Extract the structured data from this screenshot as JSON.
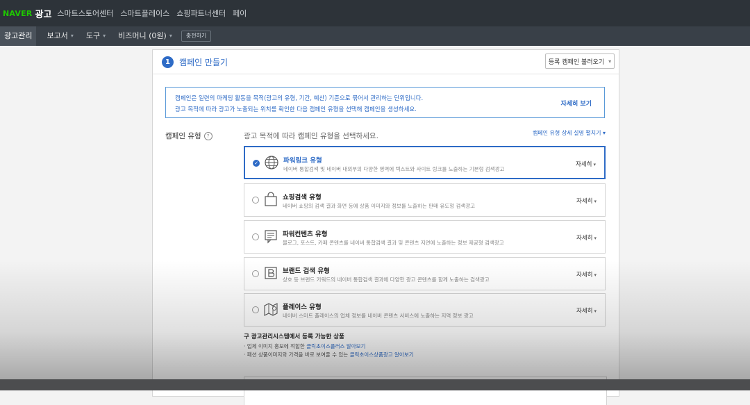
{
  "header": {
    "brand_naver": "NAVER",
    "brand_ad": "광고",
    "nav": [
      "스마트스토어센터",
      "스마트플레이스",
      "쇼핑파트너센터",
      "페이"
    ]
  },
  "subnav": {
    "items": [
      {
        "label": "광고관리",
        "active": true
      },
      {
        "label": "보고서"
      },
      {
        "label": "도구"
      },
      {
        "label": "비즈머니 (0원)"
      }
    ],
    "charge_label": "충전하기"
  },
  "card": {
    "step": "1",
    "title": "캠페인 만들기",
    "load_button": "등록 캠페인 불러오기",
    "info": {
      "line1": "캠페인은 일련의 마케팅 활동을 목적(광고의 유형, 기간, 예산) 기준으로 묶어서 관리하는 단위입니다.",
      "line2": "광고 목적에 따라 광고가 노출되는 위치를 확인한 다음 캠페인 유형을 선택해 캠페인을 생성하세요.",
      "more": "자세히 보기"
    },
    "type_label": "캠페인 유형",
    "help": "?",
    "prompt": "광고 목적에 따라 캠페인 유형을 선택하세요.",
    "expand_link": "캠페인 유형 상세 설명 펼치기 ▾"
  },
  "options": [
    {
      "title": "파워링크 유형",
      "desc": "네이버 통합검색 및 네이버 내외부의 다양한 영역에 텍스트와 사이트 링크를 노출하는 기본형 검색광고",
      "more": "자세히",
      "selected": true,
      "icon": "globe-icon"
    },
    {
      "title": "쇼핑검색 유형",
      "desc": "네이버 쇼핑의 검색 결과 화면 등에 상품 이미지와 정보를 노출하는 판매 유도형 검색광고",
      "more": "자세히",
      "selected": false,
      "icon": "shopping-bag-icon"
    },
    {
      "title": "파워컨텐츠 유형",
      "desc": "블로그, 포스트, 카페 콘텐츠를 네이버 통합검색 결과 및 콘텐츠 지면에 노출하는 정보 제공형 검색광고",
      "more": "자세히",
      "selected": false,
      "icon": "content-icon"
    },
    {
      "title": "브랜드 검색 유형",
      "desc": "상호 등 브랜드 키워드의 네이버 통합검색 결과에 다양한 광고 콘텐츠를 함께 노출하는 검색광고",
      "more": "자세히",
      "selected": false,
      "icon": "brand-b-icon"
    },
    {
      "title": "플레이스 유형",
      "desc": "네이버 스마트 플레이스의 업체 정보를 네이버 콘텐츠 서비스에 노출하는 지역 정보 광고",
      "more": "자세히",
      "selected": false,
      "icon": "place-map-icon"
    }
  ],
  "legacy": {
    "title": "구 광고관리시스템에서 등록 가능한 상품",
    "items": [
      {
        "prefix": "· 업체 이미지 홍보에 적합한 ",
        "link": "클릭초이스플러스 알아보기"
      },
      {
        "prefix": "· 패션 상품이미지와 가격을 바로 보여줄 수 있는 ",
        "link": "클릭초이스상품광고 알아보기"
      }
    ]
  },
  "colors": {
    "accent": "#2e6bc6",
    "header_bg": "#2d3339",
    "naver_green": "#1ec800"
  }
}
